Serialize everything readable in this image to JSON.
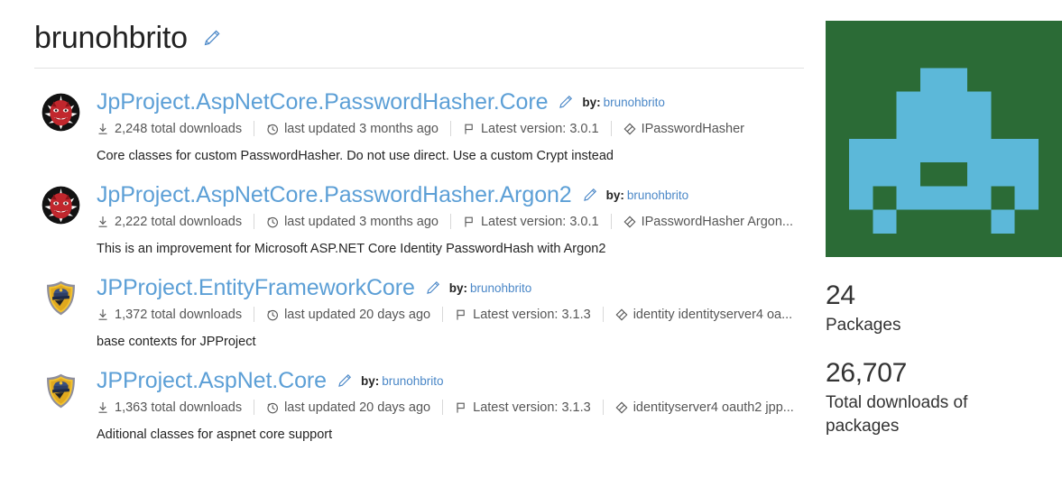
{
  "profile": {
    "username": "brunohbrito",
    "edit_icon": "pencil-icon"
  },
  "packages": [
    {
      "id": "JpProject.AspNetCore.PasswordHasher.Core",
      "title": "JpProject.AspNetCore.PasswordHasher.Core",
      "edit_icon": "pencil-icon",
      "by_label": "by:",
      "owner": "brunohbrito",
      "downloads": "2,248 total downloads",
      "downloads_icon": "download-icon",
      "updated": "last updated 3 months ago",
      "updated_icon": "clock-icon",
      "version": "Latest version: 3.0.1",
      "version_icon": "flag-icon",
      "tags": "IPasswordHasher",
      "tags_icon": "tag-icon",
      "description": "Core classes for custom PasswordHasher. Do not use direct. Use a custom Crypt instead",
      "icon_type": "devil-face-icon"
    },
    {
      "id": "JpProject.AspNetCore.PasswordHasher.Argon2",
      "title": "JpProject.AspNetCore.PasswordHasher.Argon2",
      "edit_icon": "pencil-icon",
      "by_label": "by:",
      "owner": "brunohbrito",
      "downloads": "2,222 total downloads",
      "downloads_icon": "download-icon",
      "updated": "last updated 3 months ago",
      "updated_icon": "clock-icon",
      "version": "Latest version: 3.0.1",
      "version_icon": "flag-icon",
      "tags": "IPasswordHasher Argon...",
      "tags_icon": "tag-icon",
      "description": "This is an improvement for Microsoft ASP.NET Core Identity PasswordHash with Argon2",
      "icon_type": "devil-face-icon"
    },
    {
      "id": "JPProject.EntityFrameworkCore",
      "title": "JPProject.EntityFrameworkCore",
      "edit_icon": "pencil-icon",
      "by_label": "by:",
      "owner": "brunohbrito",
      "downloads": "1,372 total downloads",
      "downloads_icon": "download-icon",
      "updated": "last updated 20 days ago",
      "updated_icon": "clock-icon",
      "version": "Latest version: 3.1.3",
      "version_icon": "flag-icon",
      "tags": "identity identityserver4 oa...",
      "tags_icon": "tag-icon",
      "description": "base contexts for JPProject",
      "icon_type": "police-badge-icon"
    },
    {
      "id": "JPProject.AspNet.Core",
      "title": "JPProject.AspNet.Core",
      "edit_icon": "pencil-icon",
      "by_label": "by:",
      "owner": "brunohbrito",
      "downloads": "1,363 total downloads",
      "downloads_icon": "download-icon",
      "updated": "last updated 20 days ago",
      "updated_icon": "clock-icon",
      "version": "Latest version: 3.1.3",
      "version_icon": "flag-icon",
      "tags": "identityserver4 oauth2 jpp...",
      "tags_icon": "tag-icon",
      "description": "Aditional classes for aspnet core support",
      "icon_type": "police-badge-icon"
    }
  ],
  "sidebar": {
    "avatar_icon": "space-invader-identicon",
    "avatar_bg_color": "#2b6b36",
    "avatar_fg_color": "#5cb8d9",
    "stats": [
      {
        "value": "24",
        "label": "Packages"
      },
      {
        "value": "26,707",
        "label": "Total downloads of packages"
      }
    ]
  },
  "colors": {
    "link": "#5c9fd6",
    "text": "#242424",
    "meta": "#565656",
    "divider": "#e2e2e2"
  }
}
